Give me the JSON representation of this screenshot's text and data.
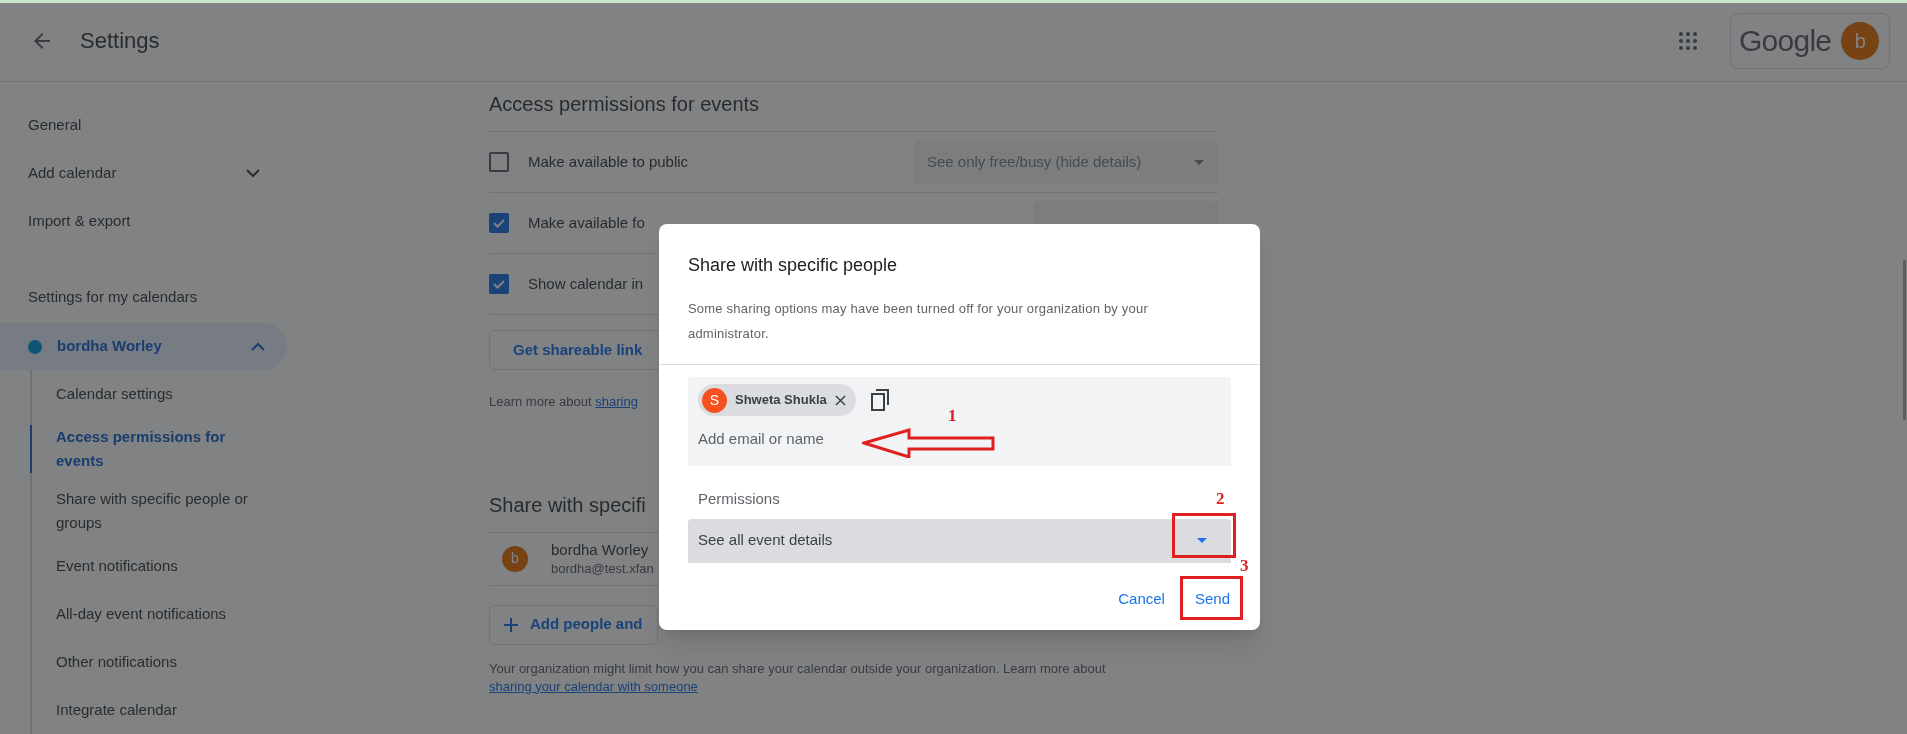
{
  "header": {
    "title": "Settings",
    "logo": "Google",
    "avatar": "b"
  },
  "sidebar": {
    "items": [
      {
        "label": "General",
        "kind": "link"
      },
      {
        "label": "Add calendar",
        "kind": "expandable",
        "expanded": false
      },
      {
        "label": "Import & export",
        "kind": "link"
      }
    ],
    "section_title": "Settings for my calendars",
    "calendar": {
      "name": "bordha Worley",
      "expanded": true
    },
    "sub_items": [
      {
        "label": "Calendar settings",
        "selected": false
      },
      {
        "label": "Access permissions for events",
        "selected": true
      },
      {
        "label": "Share with specific people or groups",
        "selected": false
      },
      {
        "label": "Event notifications",
        "selected": false
      },
      {
        "label": "All-day event notifications",
        "selected": false
      },
      {
        "label": "Other notifications",
        "selected": false
      },
      {
        "label": "Integrate calendar",
        "selected": false
      }
    ]
  },
  "main": {
    "access_title": "Access permissions for events",
    "options": [
      {
        "label": "Make available to public",
        "checked": false,
        "dropdown": "See only free/busy (hide details)"
      },
      {
        "label": "Make available fo",
        "checked": true
      },
      {
        "label": "Show calendar in",
        "checked": true
      }
    ],
    "shareable_button": "Get shareable link",
    "learn_more": {
      "text": "Learn more about ",
      "link": "sharing"
    },
    "share_title": "Share with specifi",
    "people": [
      {
        "initial": "b",
        "name": "bordha Worley",
        "email": "bordha@test.xfan"
      }
    ],
    "add_button": "Add people and",
    "footer": {
      "text": "Your organization might limit how you can share your calendar outside your organization. Learn more about",
      "link": "sharing your calendar with someone"
    }
  },
  "dialog": {
    "title": "Share with specific people",
    "description": "Some sharing options may have been turned off for your organization by your administrator.",
    "chips": [
      {
        "initial": "S",
        "name": "Shweta Shukla",
        "color": "#f4511e"
      }
    ],
    "placeholder": "Add email or name",
    "permissions_label": "Permissions",
    "permission_value": "See all event details",
    "cancel": "Cancel",
    "send": "Send"
  },
  "annotations": [
    {
      "kind": "arrow",
      "label": "1"
    },
    {
      "kind": "box",
      "label": "2"
    },
    {
      "kind": "box",
      "label": "3"
    }
  ]
}
